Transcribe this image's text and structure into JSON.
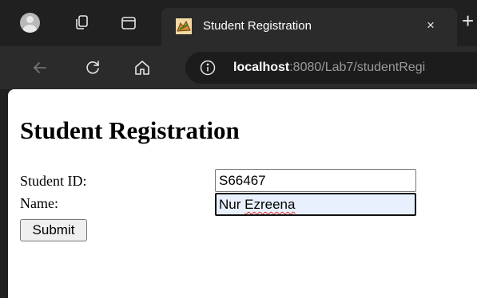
{
  "tab": {
    "title": "Student Registration",
    "close_glyph": "×",
    "new_tab_glyph": "+"
  },
  "address_bar": {
    "host": "localhost",
    "path": ":8080/Lab7/studentRegi"
  },
  "page": {
    "title": "Student Registration",
    "student_id_label": "Student ID:",
    "student_id_value": "S66467",
    "name_label": "Name:",
    "name_value_first": "Nur",
    "name_value_last": "Ezreena",
    "submit_label": "Submit"
  },
  "icons": {
    "profile": "avatar-icon",
    "workspaces": "workspaces-icon",
    "tab_actions": "tab-actions-icon",
    "favicon": "tomcat-icon",
    "back": "back-arrow-icon",
    "reload": "reload-icon",
    "home": "home-icon",
    "site_info": "info-icon"
  },
  "colors": {
    "browser_frame": "#202020",
    "toolbar": "#2b2b2b",
    "focused_input_bg": "#e8f0fe",
    "spellcheck": "#e0302c"
  }
}
